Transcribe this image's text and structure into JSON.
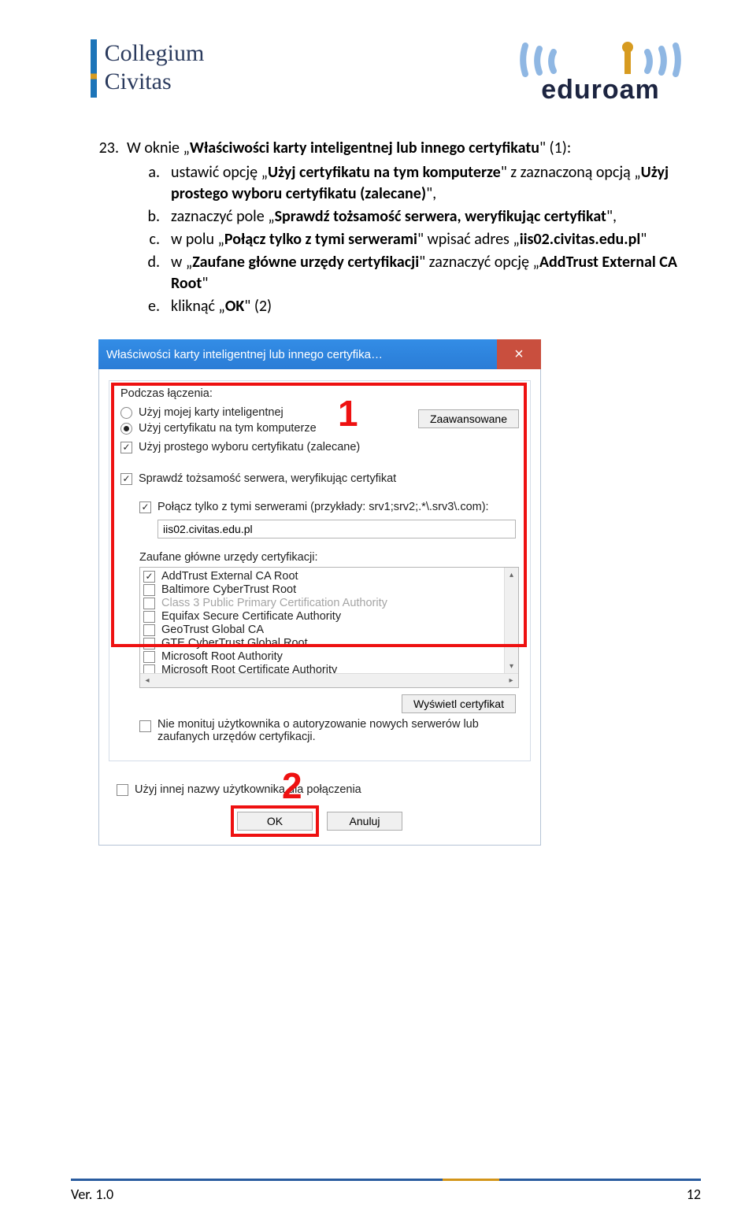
{
  "header": {
    "logo_line1": "Collegium",
    "logo_line2": "Civitas",
    "eduroam": "eduroam"
  },
  "instructions": {
    "number": "23.",
    "title_pre": "W oknie „",
    "title_bold": "Właściwości karty inteligentnej lub innego certyfikatu",
    "title_post": "\" (1):",
    "items": [
      {
        "letter": "a.",
        "pre": "ustawić opcję „",
        "b1": "Użyj certyfikatu na tym komputerze",
        "mid": "\" z zaznaczoną opcją „",
        "b2": "Użyj prostego wyboru certyfikatu (zalecane)",
        "post": "\","
      },
      {
        "letter": "b.",
        "pre": "zaznaczyć pole „",
        "b1": "Sprawdź tożsamość serwera, weryfikując certyfikat",
        "post": "\","
      },
      {
        "letter": "c.",
        "pre": "w polu „",
        "b1": "Połącz tylko z tymi serwerami",
        "mid": "\" wpisać adres „",
        "b2": "iis02.civitas.edu.pl",
        "post": "\""
      },
      {
        "letter": "d.",
        "pre": "w „",
        "b1": "Zaufane główne urzędy certyfikacji",
        "mid": "\" zaznaczyć opcję „",
        "b2": "AddTrust External CA Root",
        "post": "\""
      },
      {
        "letter": "e.",
        "pre": "kliknąć „",
        "b1": "OK",
        "post": "\" (2)"
      }
    ]
  },
  "dialog": {
    "title": "Właściwości karty inteligentnej lub innego certyfika…",
    "close": "×",
    "group1_label": "Podczas łączenia:",
    "radio1": "Użyj mojej karty inteligentnej",
    "radio2": "Użyj certyfikatu na tym komputerze",
    "cb_simple": "Użyj prostego wyboru certyfikatu (zalecane)",
    "btn_advanced": "Zaawansowane",
    "cb_verify": "Sprawdź tożsamość serwera, weryfikując certyfikat",
    "cb_connect": "Połącz tylko z tymi serwerami (przykłady: srv1;srv2;.*\\.srv3\\.com):",
    "server_value": "iis02.civitas.edu.pl",
    "ca_label": "Zaufane główne urzędy certyfikacji:",
    "ca_items": [
      {
        "label": "AddTrust External CA Root",
        "checked": true
      },
      {
        "label": "Baltimore CyberTrust Root",
        "checked": false
      },
      {
        "label": "Class 3 Public Primary Certification Authority",
        "checked": false,
        "obscured": true
      },
      {
        "label": "Equifax Secure Certificate Authority",
        "checked": false
      },
      {
        "label": "GeoTrust Global CA",
        "checked": false
      },
      {
        "label": "GTE CyberTrust Global Root",
        "checked": false
      },
      {
        "label": "Microsoft Root Authority",
        "checked": false
      },
      {
        "label": "Microsoft Root Certificate Authority",
        "checked": false
      }
    ],
    "btn_viewcert": "Wyświetl certyfikat",
    "cb_noprompt_l1": "Nie monituj użytkownika o autoryzowanie nowych serwerów lub",
    "cb_noprompt_l2": "zaufanych urzędów certyfikacji.",
    "cb_diffuser": "Użyj innej nazwy użytkownika dla połączenia",
    "btn_ok": "OK",
    "btn_cancel": "Anuluj",
    "marker1": "1",
    "marker2": "2"
  },
  "footer": {
    "version": "Ver. 1.0",
    "page": "12"
  }
}
